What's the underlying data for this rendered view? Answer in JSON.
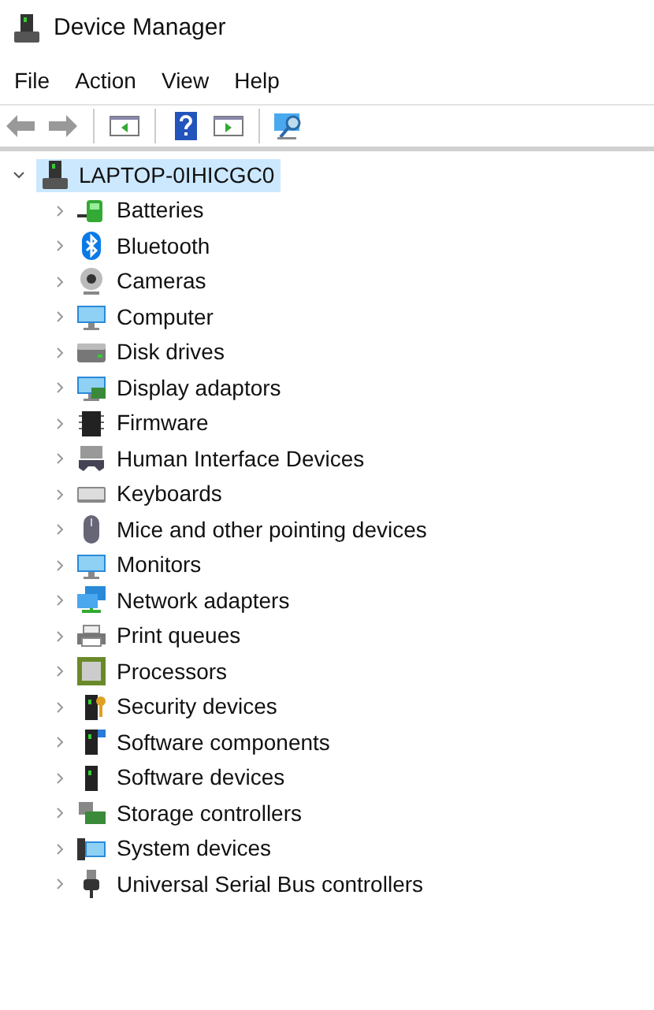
{
  "window": {
    "title": "Device Manager"
  },
  "menu": [
    "File",
    "Action",
    "View",
    "Help"
  ],
  "tree": {
    "label": "LAPTOP-0IHICGC0",
    "expanded": true,
    "selected": true,
    "children": [
      {
        "label": "Batteries",
        "expanded": false
      },
      {
        "label": "Bluetooth",
        "expanded": false
      },
      {
        "label": "Cameras",
        "expanded": false
      },
      {
        "label": "Computer",
        "expanded": false
      },
      {
        "label": "Disk drives",
        "expanded": false
      },
      {
        "label": "Display adaptors",
        "expanded": false
      },
      {
        "label": "Firmware",
        "expanded": false
      },
      {
        "label": "Human Interface Devices",
        "expanded": false
      },
      {
        "label": "Keyboards",
        "expanded": false
      },
      {
        "label": "Mice and other pointing devices",
        "expanded": false
      },
      {
        "label": "Monitors",
        "expanded": false
      },
      {
        "label": "Network adapters",
        "expanded": false
      },
      {
        "label": "Print queues",
        "expanded": false
      },
      {
        "label": "Processors",
        "expanded": false
      },
      {
        "label": "Security devices",
        "expanded": false
      },
      {
        "label": "Software components",
        "expanded": false
      },
      {
        "label": "Software devices",
        "expanded": false
      },
      {
        "label": "Storage controllers",
        "expanded": false
      },
      {
        "label": "System devices",
        "expanded": false
      },
      {
        "label": "Universal Serial Bus controllers",
        "expanded": false
      }
    ]
  }
}
